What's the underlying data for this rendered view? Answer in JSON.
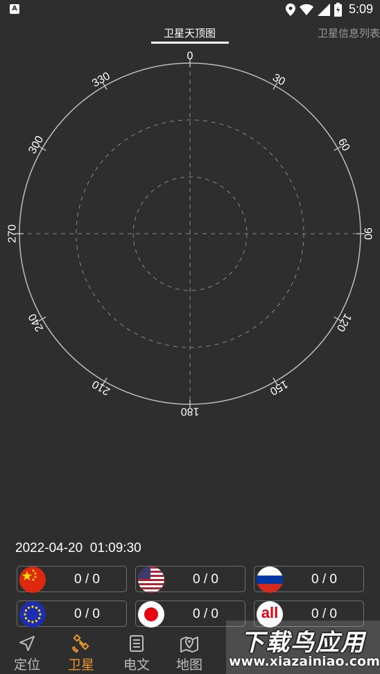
{
  "status_bar": {
    "app_icon": "A",
    "icons": [
      "location-icon",
      "wifi-icon",
      "signal-icon",
      "battery-icon"
    ],
    "time": "5:09"
  },
  "tabs": [
    {
      "label": "卫星天顶图",
      "active": true
    },
    {
      "label": "卫星信息列表",
      "active": false
    }
  ],
  "skyplot": {
    "azimuth_labels": [
      "0",
      "30",
      "60",
      "90",
      "120",
      "150",
      "180",
      "210",
      "240",
      "270",
      "300",
      "330"
    ],
    "ring_color": "#bdbdbd",
    "grid_color": "#8a8a8a"
  },
  "timestamp": "2022-04-20  01:09:30",
  "constellations": [
    {
      "id": "beidou",
      "flag": "china-flag-icon",
      "value": "0 / 0"
    },
    {
      "id": "gps",
      "flag": "usa-flag-icon",
      "value": "0 / 0"
    },
    {
      "id": "glonass",
      "flag": "russia-flag-icon",
      "value": "0 / 0"
    },
    {
      "id": "galileo",
      "flag": "eu-flag-icon",
      "value": "0 / 0"
    },
    {
      "id": "qzss",
      "flag": "japan-flag-icon",
      "value": "0 / 0"
    },
    {
      "id": "all",
      "flag": "all-icon",
      "flag_text": "all",
      "value": "0 / 0"
    }
  ],
  "bottom_nav": [
    {
      "label": "定位",
      "icon": "navigation-arrow-icon",
      "active": false
    },
    {
      "label": "卫星",
      "icon": "satellite-icon",
      "active": true
    },
    {
      "label": "电文",
      "icon": "document-icon",
      "active": false
    },
    {
      "label": "地图",
      "icon": "map-pin-icon",
      "active": false
    }
  ],
  "watermark": {
    "title": "下载鸟应用",
    "url": "www.xiazainiao.com"
  },
  "colors": {
    "background": "#2e2e2e",
    "accent": "#e8962a",
    "text": "#ffffff",
    "muted": "#9a9a9a"
  }
}
